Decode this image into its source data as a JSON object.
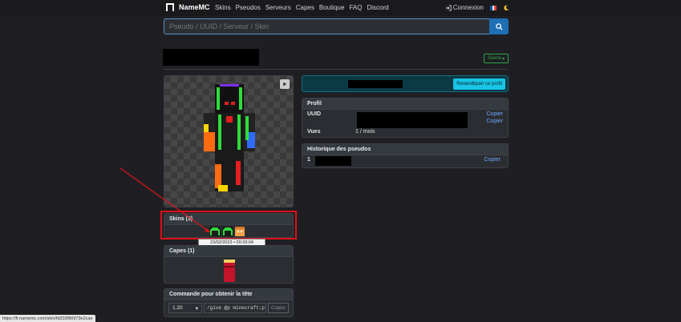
{
  "nav": {
    "brand": "NameMC",
    "links": [
      "Skins",
      "Pseudos",
      "Serveurs",
      "Capes",
      "Boutique",
      "FAQ",
      "Discord"
    ],
    "login": "Connexion"
  },
  "search": {
    "placeholder": "Pseudo / UUID / Serveur / Skin"
  },
  "profile_header": {
    "follow_label": "Suivre"
  },
  "claim": {
    "button_label": "Revendiquer ce profil"
  },
  "profile": {
    "title": "Profil",
    "uuid_label": "UUID",
    "copy_1": "Copier",
    "copy_2": "Copier",
    "views_label": "Vues",
    "views_value": "1 / mois"
  },
  "history": {
    "title": "Historique des pseudos",
    "index": "1",
    "copy": "Copier"
  },
  "skins": {
    "title": "Skins (3)",
    "tooltip": "23/02/2023 • 09:33:04"
  },
  "capes": {
    "title": "Capes (1)"
  },
  "command": {
    "title": "Commande pour obtenir la tête",
    "version": "1.20",
    "command_text": "/give @p minecraft:player_head",
    "copy": "Copier"
  },
  "status_url": "https://fr.namemc.com/skin/fd333f90973e2cae"
}
